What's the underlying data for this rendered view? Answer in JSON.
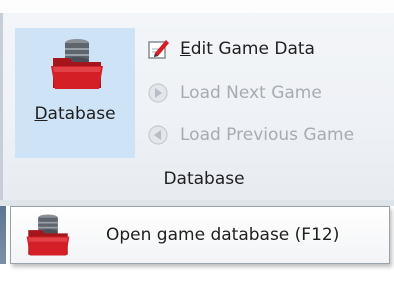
{
  "ribbon": {
    "database_button": {
      "label": "Database",
      "mnemonic": "D",
      "label_rest": "atabase",
      "icon": "database-folder-icon"
    },
    "commands": [
      {
        "id": "edit",
        "mnemonic": "E",
        "label_rest": "dit Game Data",
        "enabled": true,
        "icon": "edit-pencil-icon"
      },
      {
        "id": "next",
        "label": "Load Next Game",
        "enabled": false,
        "icon": "load-next-arrow-icon"
      },
      {
        "id": "prev",
        "label": "Load Previous Game",
        "enabled": false,
        "icon": "load-previous-arrow-icon"
      }
    ],
    "group_label": "Database"
  },
  "tooltip": {
    "text": "Open game database (F12)",
    "icon": "database-folder-icon"
  },
  "colors": {
    "selected_button_bg": "#cfe3f6",
    "disabled_text": "#a7acb2",
    "folder_red": "#d41f26"
  }
}
